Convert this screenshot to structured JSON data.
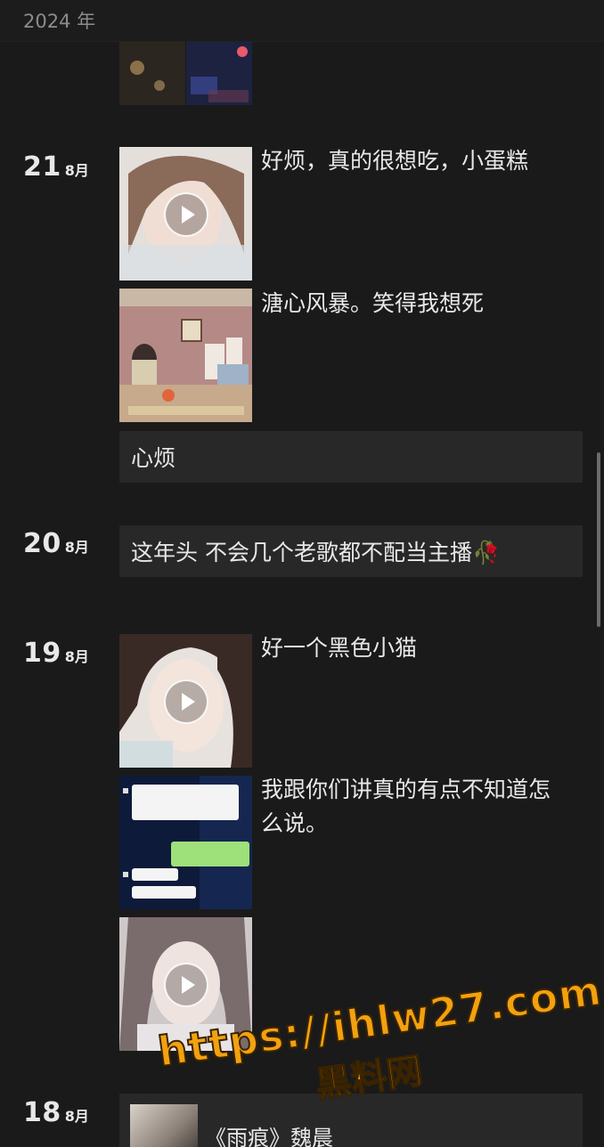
{
  "header": {
    "year": "2024 年"
  },
  "days": [
    {
      "day": "21",
      "month": "8月"
    },
    {
      "day": "20",
      "month": "8月"
    },
    {
      "day": "19",
      "month": "8月"
    },
    {
      "day": "18",
      "month": "8月"
    }
  ],
  "posts": {
    "p21a": "好烦，真的很想吃，小蛋糕",
    "p21b": "溏心风暴。笑得我想死",
    "p21c": "心烦",
    "p20a": "这年头 不会几个老歌都不配当主播🥀",
    "p19a": "好一个黑色小猫",
    "p19b": "我跟你们讲真的有点不知道怎么说。",
    "p18a": "《雨痕》魏晨"
  },
  "watermark": {
    "url": "https://ihlw27.com",
    "name": "黑料网"
  },
  "colors": {
    "background": "#1a1a1a",
    "card": "#282828",
    "watermark": "#f2a10f"
  }
}
